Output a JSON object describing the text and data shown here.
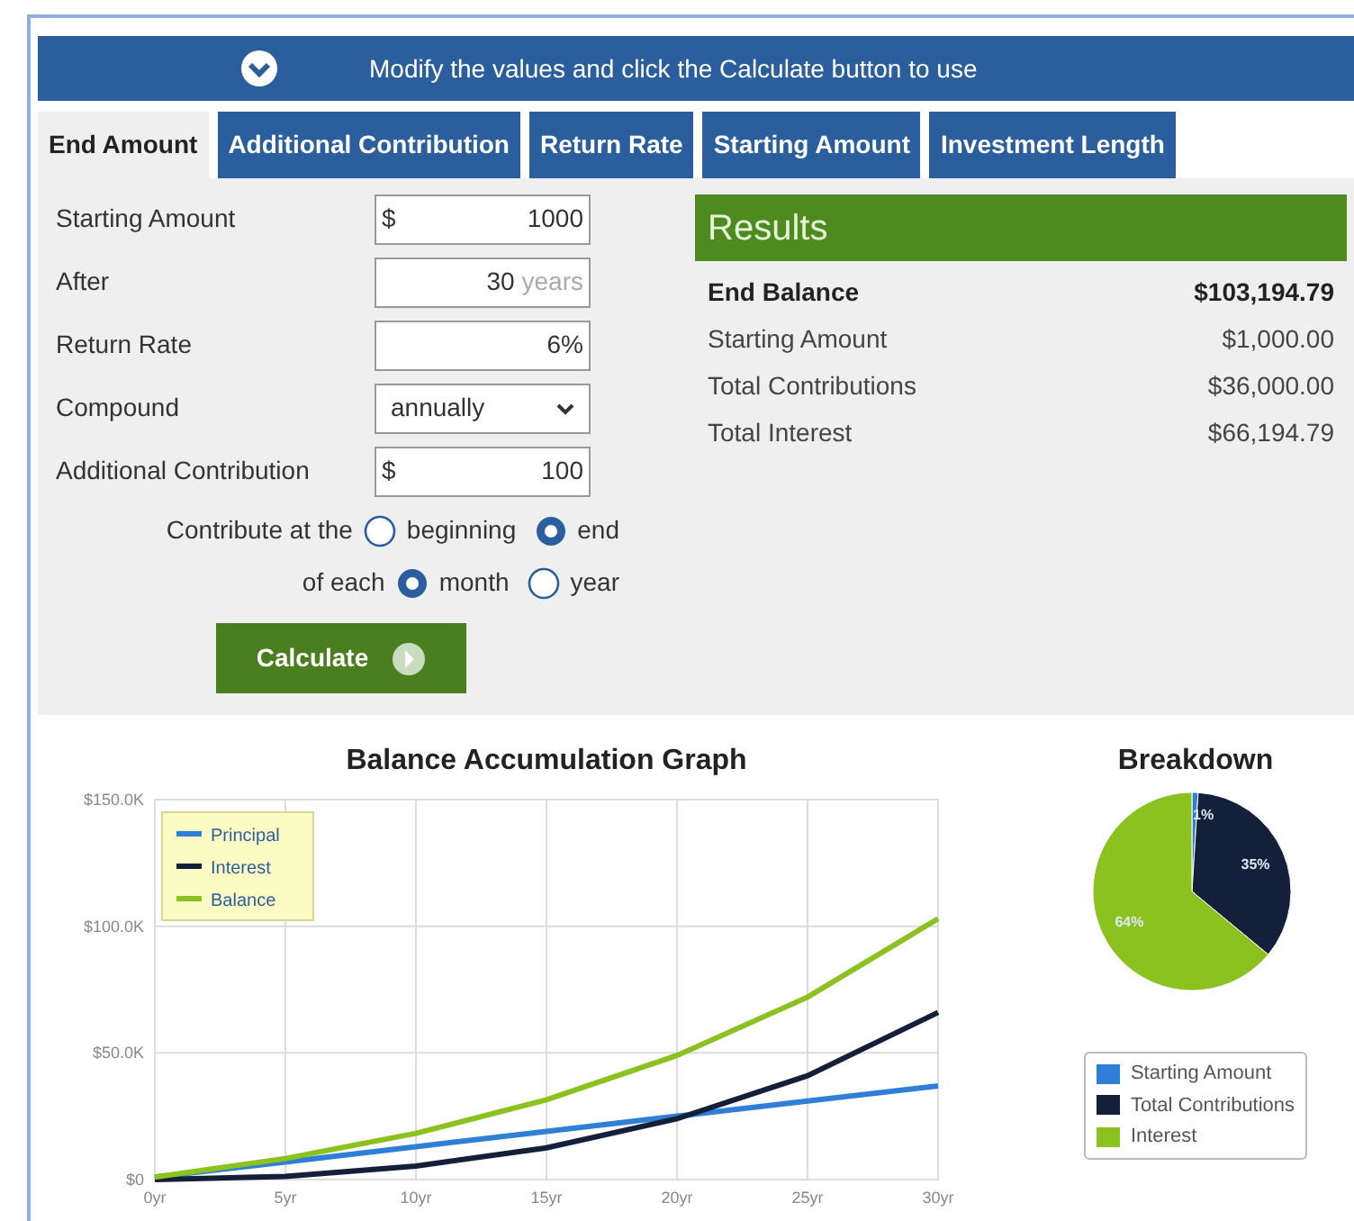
{
  "header": {
    "text": "Modify the values and click the Calculate button to use"
  },
  "tabs": [
    {
      "label": "End Amount",
      "selected": true
    },
    {
      "label": "Additional Contribution",
      "selected": false
    },
    {
      "label": "Return Rate",
      "selected": false
    },
    {
      "label": "Starting Amount",
      "selected": false
    },
    {
      "label": "Investment Length",
      "selected": false
    }
  ],
  "form": {
    "fields": [
      {
        "kind": "input",
        "label": "Starting Amount",
        "prefix": "$",
        "value": "1000"
      },
      {
        "kind": "input",
        "label": "After",
        "value": "30",
        "suffix": "years"
      },
      {
        "kind": "input",
        "label": "Return Rate",
        "value": "6%"
      },
      {
        "kind": "select",
        "label": "Compound",
        "value": "annually"
      },
      {
        "kind": "input",
        "label": "Additional Contribution",
        "prefix": "$",
        "value": "100"
      }
    ],
    "radio_groups": [
      {
        "label": "Contribute at the",
        "options": [
          {
            "label": "beginning",
            "selected": false
          },
          {
            "label": "end",
            "selected": true
          }
        ]
      },
      {
        "label": "of each",
        "options": [
          {
            "label": "month",
            "selected": true
          },
          {
            "label": "year",
            "selected": false
          }
        ]
      }
    ],
    "calculate_button": "Calculate"
  },
  "results": {
    "title": "Results",
    "rows": [
      {
        "label": "End Balance",
        "value": "$103,194.79",
        "emphasis": true
      },
      {
        "label": "Starting Amount",
        "value": "$1,000.00",
        "emphasis": false
      },
      {
        "label": "Total Contributions",
        "value": "$36,000.00",
        "emphasis": false
      },
      {
        "label": "Total Interest",
        "value": "$66,194.79",
        "emphasis": false
      }
    ]
  },
  "balance_graph": {
    "chart_data": {
      "type": "line",
      "title": "Balance Accumulation Graph",
      "x": [
        0,
        5,
        10,
        15,
        20,
        25,
        30
      ],
      "series": [
        {
          "name": "Principal",
          "color": "#2f7fd6",
          "values": [
            1000,
            7000,
            13000,
            19000,
            25000,
            31000,
            37000
          ]
        },
        {
          "name": "Interest",
          "color": "#14203a",
          "values": [
            0,
            1300,
            5300,
            12500,
            24000,
            41000,
            66000
          ]
        },
        {
          "name": "Balance",
          "color": "#8cc21f",
          "values": [
            1000,
            8300,
            18300,
            31500,
            49000,
            72000,
            103000
          ]
        }
      ],
      "grid": true,
      "legend": true,
      "xlim": [
        0,
        30
      ],
      "ylim": [
        0,
        150000
      ],
      "xticks": [
        {
          "value": 0,
          "label": "0yr"
        },
        {
          "value": 5,
          "label": "5yr"
        },
        {
          "value": 10,
          "label": "10yr"
        },
        {
          "value": 15,
          "label": "15yr"
        },
        {
          "value": 20,
          "label": "20yr"
        },
        {
          "value": 25,
          "label": "25yr"
        },
        {
          "value": 30,
          "label": "30yr"
        }
      ],
      "yticks": [
        {
          "value": 0,
          "label": "$0"
        },
        {
          "value": 50000,
          "label": "$50.0K"
        },
        {
          "value": 100000,
          "label": "$100.0K"
        },
        {
          "value": 150000,
          "label": "$150.0K"
        }
      ]
    }
  },
  "breakdown": {
    "chart_data": {
      "type": "pie",
      "title": "Breakdown",
      "categories": [
        "Starting Amount",
        "Total Contributions",
        "Interest"
      ],
      "values": [
        1,
        35,
        64
      ],
      "colors": [
        "#2f7fd6",
        "#14203a",
        "#8cc21f"
      ],
      "legend": true,
      "value_labels": [
        "1%",
        "35%",
        "64%"
      ]
    }
  }
}
